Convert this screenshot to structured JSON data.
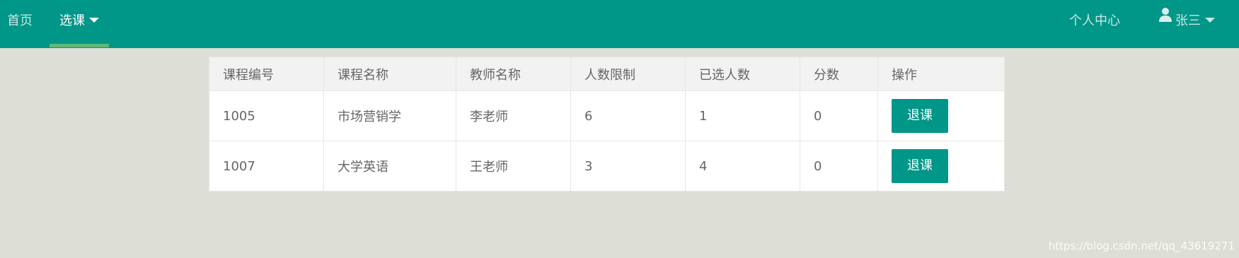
{
  "nav": {
    "home": "首页",
    "select": "选课",
    "personal_center": "个人中心",
    "user": "张三"
  },
  "colors": {
    "header_bg": "#009688",
    "active_underline": "#5fb878",
    "page_bg": "#dddfd7",
    "button_bg": "#009688"
  },
  "table": {
    "headers": [
      "课程编号",
      "课程名称",
      "教师名称",
      "人数限制",
      "已选人数",
      "分数",
      "操作"
    ],
    "rows": [
      {
        "id": "1005",
        "name": "市场营销学",
        "teacher": "李老师",
        "limit": "6",
        "selected": "1",
        "score": "0",
        "action": "退课"
      },
      {
        "id": "1007",
        "name": "大学英语",
        "teacher": "王老师",
        "limit": "3",
        "selected": "4",
        "score": "0",
        "action": "退课"
      }
    ]
  },
  "watermark": "https://blog.csdn.net/qq_43619271"
}
